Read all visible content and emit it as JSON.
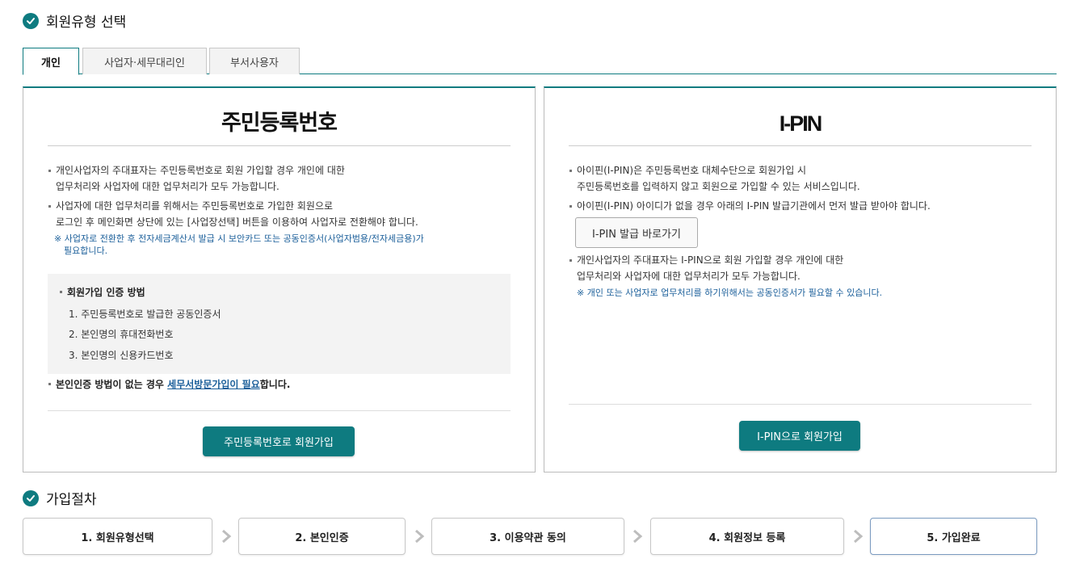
{
  "sections": {
    "member_type_title": "회원유형 선택",
    "procedure_title": "가입절차"
  },
  "tabs": [
    {
      "label": "개인",
      "active": true
    },
    {
      "label": "사업자·세무대리인",
      "active": false
    },
    {
      "label": "부서사용자",
      "active": false
    }
  ],
  "resident_panel": {
    "heading": "주민등록번호",
    "bullets": [
      {
        "line1": "개인사업자의 주대표자는 주민등록번호로 회원 가입할 경우 개인에 대한",
        "line2": "업무처리와 사업자에 대한 업무처리가 모두 가능합니다."
      },
      {
        "line1": "사업자에 대한 업무처리를 위해서는 주민등록번호로 가입한 회원으로",
        "line2": "로그인 후 메인화면 상단에 있는 [사업장선택] 버튼을 이용하여 사업자로 전환해야 합니다."
      }
    ],
    "note_line1": "※ 사업자로 전환한 후 전자세금계산서 발급 시 보안카드 또는 공동인증서(사업자범용/전자세금용)가",
    "note_line2": "필요합니다.",
    "auth_methods_title": "회원가입 인증 방법",
    "auth_methods": [
      "1. 주민등록번호로 발급한 공동인증서",
      "2. 본인명의 휴대전화번호",
      "3. 본인명의 신용카드번호"
    ],
    "no_auth_prefix": "본인인증 방법이 없는 경우 ",
    "no_auth_link": "세무서방문가입이 필요",
    "no_auth_suffix": "합니다.",
    "join_button": "주민등록번호로 회원가입"
  },
  "ipin_panel": {
    "heading": "I-PIN",
    "bullet1_line1": "아이핀(I-PIN)은 주민등록번호 대체수단으로 회원가입 시",
    "bullet1_line2": "주민등록번호를 입력하지 않고 회원으로 가입할 수 있는 서비스입니다.",
    "bullet2": "아이핀(I-PIN) 아이디가 없을 경우 아래의 I-PIN 발급기관에서 먼저 발급 받아야 합니다.",
    "issue_button": "I-PIN 발급 바로가기",
    "bullet3_line1": "개인사업자의 주대표자는 I-PIN으로 회원 가입할 경우 개인에 대한",
    "bullet3_line2": "업무처리와 사업자에 대한 업무처리가 모두 가능합니다.",
    "note": "※ 개인 또는 사업자로 업무처리를 하기위해서는 공동인증서가 필요할 수 있습니다.",
    "join_button": "I-PIN으로 회원가입"
  },
  "steps": [
    {
      "label": "1. 회원유형선택",
      "current": false
    },
    {
      "label": "2. 본인인증",
      "current": false
    },
    {
      "label": "3. 이용약관 동의",
      "current": false
    },
    {
      "label": "4. 회원정보 등록",
      "current": false
    },
    {
      "label": "5. 가입완료",
      "current": true
    }
  ],
  "colors": {
    "accent": "#0e7b80",
    "note_text": "#1b5f9a",
    "current_step_border": "#7a9ac0"
  }
}
